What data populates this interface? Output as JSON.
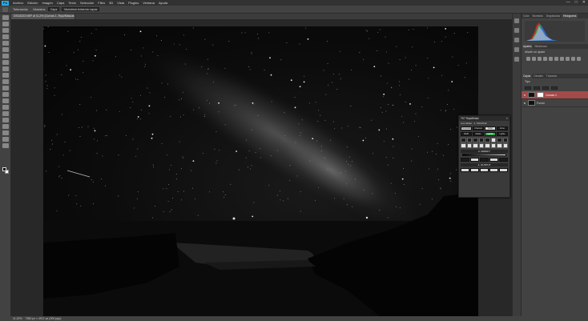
{
  "app": {
    "logo": "Ps",
    "menu": [
      "Archivo",
      "Edición",
      "Imagen",
      "Capa",
      "Texto",
      "Selección",
      "Filtro",
      "3D",
      "Vista",
      "Plugins",
      "Ventana",
      "Ayuda"
    ],
    "window_controls": [
      "—",
      "□",
      "✕"
    ]
  },
  "options_bar": {
    "items": [
      "Tolerancia:",
      "Muestra:",
      "Capa"
    ],
    "selected_sample": "Muestrear todas las capas"
  },
  "document": {
    "tab_title": "DSC6223.NEF al 11,2% (Curvas 1, Rojo/Máscara/8) *",
    "zoom": "11,22%",
    "status_text": "7360 px × 4912 px (300 ppp)"
  },
  "panels": {
    "top_tabs": [
      "Color",
      "Muestras",
      "Degradados",
      "Histograma"
    ],
    "active_top_tab": "Histograma",
    "adjust_tabs": [
      "Ajustes",
      "Bibliotecas"
    ],
    "adjust_title": "Añadir un ajuste",
    "layers_tabs": [
      "Capas",
      "Canales",
      "Trazados"
    ],
    "layers_filter": "Tipo",
    "layers": [
      {
        "name": "Curvas 1",
        "active": true,
        "has_mask": true
      },
      {
        "name": "Fondo",
        "active": false,
        "has_mask": false
      }
    ]
  },
  "tk_panel": {
    "title": "TK7 RapidMask",
    "mode": "Lum Mask",
    "source_label": "1. SOURCE",
    "mode_buttons": [
      "Composite",
      "Channel",
      "Color",
      "Zone"
    ],
    "row_labels": [
      "RGB",
      "Darks",
      "Lights"
    ],
    "green_button": "MASK",
    "modify_label": "2. MODIFY",
    "output_label": "3. OUTPUT"
  },
  "colors": {
    "accent_active_layer": "#a34a4a",
    "tk_green": "#2aa94a"
  }
}
